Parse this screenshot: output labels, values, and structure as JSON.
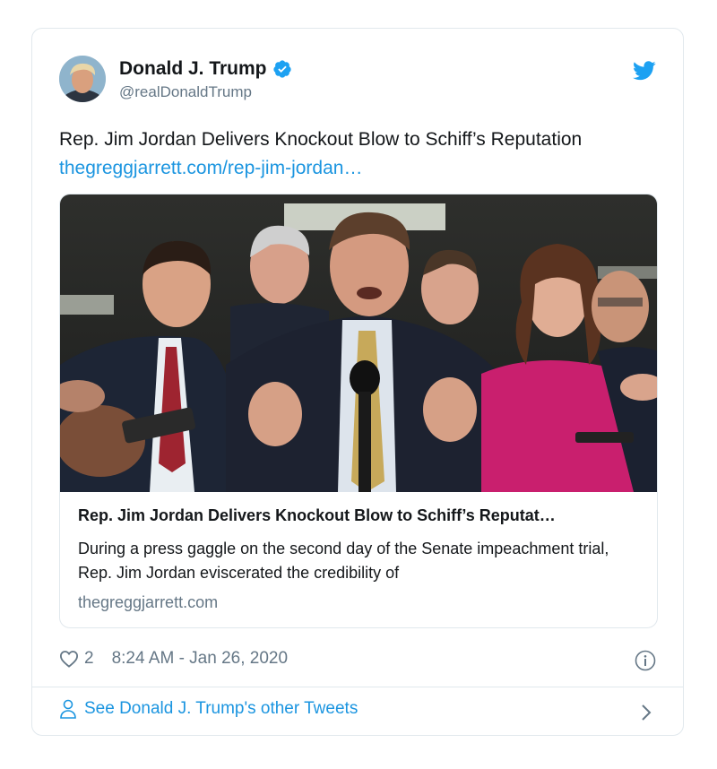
{
  "author": {
    "name": "Donald J. Trump",
    "handle": "@realDonaldTrump"
  },
  "tweet": {
    "text": "Rep. Jim Jordan Delivers Knockout Blow to Schiff’s Reputation",
    "link_text": "thegreggjarrett.com/rep-jim-jordan…"
  },
  "card": {
    "title": "Rep. Jim Jordan Delivers Knockout Blow to Schiff’s Reputat…",
    "description": "During a press gaggle on the second day of the Senate impeachment trial, Rep. Jim Jordan eviscerated the credibility of",
    "domain": "thegreggjarrett.com"
  },
  "meta": {
    "likes": "2",
    "timestamp": "8:24 AM - Jan 26, 2020"
  },
  "footer": {
    "see_other_label": "See Donald J. Trump's other Tweets"
  },
  "icons": {
    "verified": "verified-badge-icon",
    "bird": "twitter-bird-icon",
    "heart": "heart-icon",
    "info": "info-icon",
    "person": "person-icon",
    "chevron": "chevron-right-icon"
  },
  "colors": {
    "link": "#1b95e0",
    "muted": "#657786",
    "border": "#e1e8ed",
    "text": "#14171a"
  }
}
